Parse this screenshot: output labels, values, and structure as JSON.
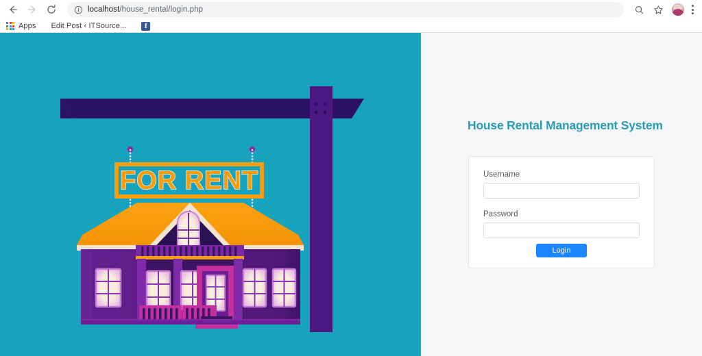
{
  "browser": {
    "back_icon": "back-arrow-icon",
    "forward_icon": "forward-arrow-icon",
    "reload_icon": "reload-icon",
    "info_icon": "info-circle-icon",
    "url_host": "localhost",
    "url_path": "/house_rental/login.php",
    "url_full": "localhost/house_rental/login.php",
    "search_icon": "search-icon",
    "star_icon": "star-bookmark-icon",
    "avatar_icon": "profile-avatar",
    "menu_icon": "three-dot-menu-icon"
  },
  "bookmarks": {
    "apps_icon": "apps-grid-icon",
    "apps_label": "Apps",
    "items": [
      {
        "label": "Edit Post ‹ ITSource...",
        "icon": "bookmark-icon"
      },
      {
        "label": "",
        "icon": "facebook-icon",
        "glyph": "f"
      }
    ]
  },
  "login": {
    "title": "House Rental Management System",
    "username_label": "Username",
    "username_value": "",
    "username_placeholder": "",
    "password_label": "Password",
    "password_value": "",
    "password_placeholder": "",
    "submit_label": "Login"
  },
  "illustration": {
    "sign_text": "FOR RENT",
    "alt": "house-for-rent-illustration"
  },
  "colors": {
    "teal_panel": "#17a2bd",
    "right_panel": "#f6f7f9",
    "title_teal": "#2b9cb7",
    "button_blue": "#1a85fd",
    "roof_orange": "#f79e0f",
    "house_purple": "#5b1d84",
    "house_purple_dark": "#3d1464",
    "beam_navy": "#2a1164",
    "post_purple": "#4a1880",
    "door_magenta": "#c42fa0",
    "window_cream": "#f7eedd"
  }
}
